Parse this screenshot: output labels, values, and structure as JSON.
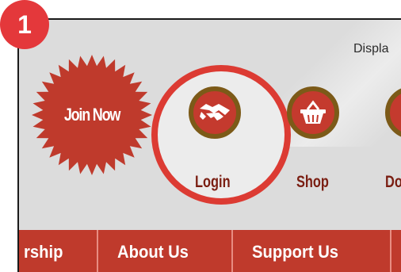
{
  "step_badge": "1",
  "header": {
    "display_text": "Displa"
  },
  "join": {
    "label": "Join Now",
    "color": "#bf3a2c"
  },
  "quick_links": [
    {
      "label": "Login",
      "icon": "handshake-icon",
      "highlighted": true
    },
    {
      "label": "Shop",
      "icon": "basket-icon"
    },
    {
      "label": "Don",
      "icon": "donate-icon"
    }
  ],
  "nav": {
    "items": [
      "rship",
      "About Us",
      "Support Us"
    ]
  },
  "colors": {
    "accent": "#bf3a2c",
    "highlight_ring": "#dc3b33",
    "icon_border": "#7c5a18",
    "label_text": "#7a1e12"
  }
}
